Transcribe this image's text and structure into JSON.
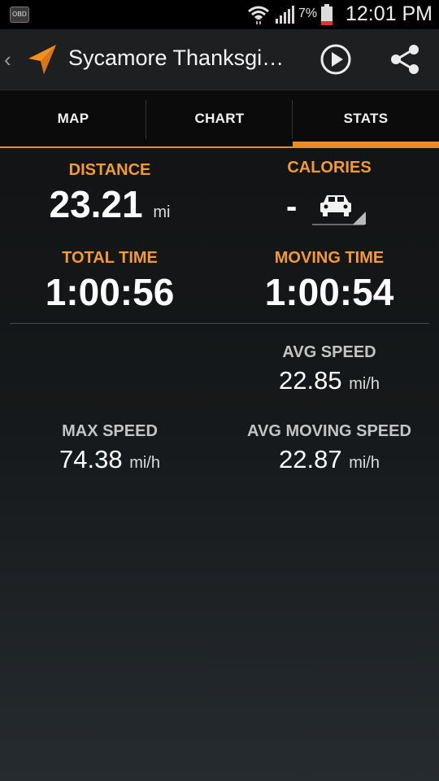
{
  "status_bar": {
    "notification_icon_text": "OBD",
    "battery": "7%",
    "time": "12:01 PM"
  },
  "action_bar": {
    "title": "Sycamore Thanksgi…",
    "icons": [
      "back-chevron-icon",
      "navigation-arrow-icon",
      "play-icon",
      "share-icon"
    ],
    "accent_color": "#f0901e"
  },
  "tabs": [
    {
      "label": "MAP",
      "active": false
    },
    {
      "label": "CHART",
      "active": false
    },
    {
      "label": "STATS",
      "active": true
    }
  ],
  "stats": {
    "distance": {
      "label": "DISTANCE",
      "value": "23.21",
      "unit": "mi"
    },
    "calories": {
      "label": "CALORIES",
      "value": "-",
      "activity_icon": "car-icon"
    },
    "total_time": {
      "label": "TOTAL TIME",
      "value": "1:00:56"
    },
    "moving_time": {
      "label": "MOVING TIME",
      "value": "1:00:54"
    },
    "avg_speed": {
      "label": "AVG SPEED",
      "value": "22.85",
      "unit": "mi/h"
    },
    "max_speed": {
      "label": "MAX SPEED",
      "value": "74.38",
      "unit": "mi/h"
    },
    "avg_moving_speed": {
      "label": "AVG MOVING SPEED",
      "value": "22.87",
      "unit": "mi/h"
    }
  },
  "colors": {
    "label_orange": "#f29a34",
    "label_grey": "#c4c4c4",
    "tab_indicator": "#f08a24"
  }
}
